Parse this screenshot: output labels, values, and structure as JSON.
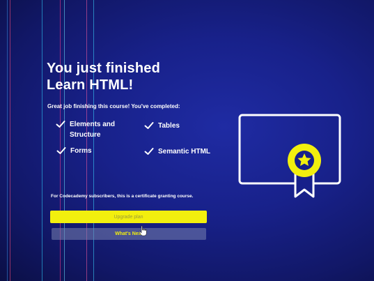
{
  "completion": {
    "title_line1": "You just finished",
    "title_line2": "Learn HTML!",
    "subtitle": "Great job finishing this course! You've completed:",
    "items": [
      {
        "label": "Elements and Structure"
      },
      {
        "label": "Tables"
      },
      {
        "label": "Forms"
      },
      {
        "label": "Semantic HTML"
      }
    ],
    "note": "For Codecademy subscribers, this is a certificate granting course."
  },
  "actions": {
    "upgrade_label": "Upgrade plan",
    "next_label": "What's Next"
  },
  "icons": {
    "check": "check-icon",
    "certificate": "certificate-icon",
    "cursor": "cursor-icon"
  },
  "colors": {
    "background": "#18218a",
    "accent": "#f2ef0e",
    "text": "#ffffff",
    "next_button": "#7882af"
  }
}
